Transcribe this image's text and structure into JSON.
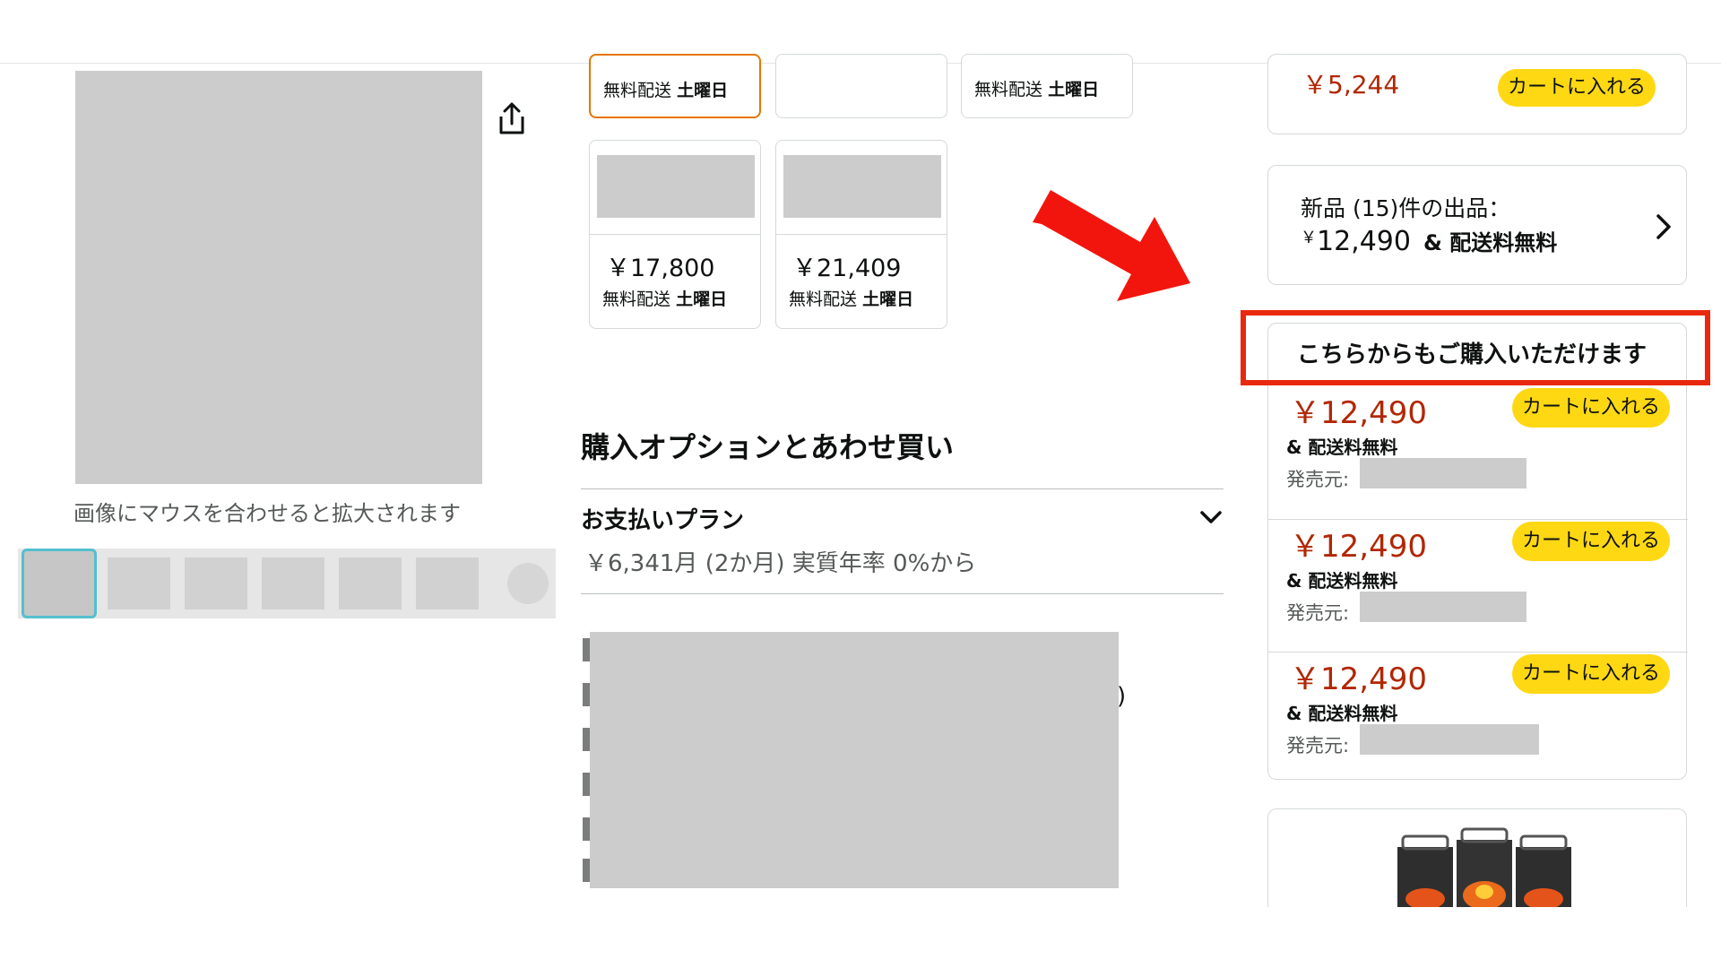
{
  "gallery": {
    "zoom_hint": "画像にマウスを合わせると拡大されます"
  },
  "variants": {
    "top_row": [
      {
        "shipping": "無料配送",
        "day": "土曜日"
      },
      {
        "shipping": "",
        "day": ""
      },
      {
        "shipping": "無料配送",
        "day": "土曜日"
      }
    ],
    "second_row": [
      {
        "price": "￥17,800",
        "shipping": "無料配送",
        "day": "土曜日"
      },
      {
        "price": "￥21,409",
        "shipping": "無料配送",
        "day": "土曜日"
      }
    ]
  },
  "purchase_options": {
    "title": "購入オプションとあわせ買い",
    "plan_label": "お支払いプラン",
    "plan_value": "￥6,341月 (2か月) 実質年率 0%から",
    "details_paren": ")"
  },
  "buybox": {
    "top_price": "￥5,244",
    "cart_label": "カートに入れる",
    "new_offers": {
      "title": "新品 (15)件の出品：",
      "currency": "￥",
      "price": "12,490",
      "free_shipping": "& 配送料無料"
    },
    "alt_header": "こちらからもご購入いただけます",
    "offers": [
      {
        "price": "￥12,490",
        "shipping": "& 配送料無料",
        "seller_label": "発売元:",
        "cart_label": "カートに入れる"
      },
      {
        "price": "￥12,490",
        "shipping": "& 配送料無料",
        "seller_label": "発売元:",
        "cart_label": "カートに入れる"
      },
      {
        "price": "￥12,490",
        "shipping": "& 配送料無料",
        "seller_label": "発売元:",
        "cart_label": "カートに入れる"
      }
    ]
  },
  "colors": {
    "price_red": "#b12704",
    "cart_yellow": "#ffd814",
    "highlight_red": "#e8290f",
    "selected_orange": "#e77600"
  }
}
